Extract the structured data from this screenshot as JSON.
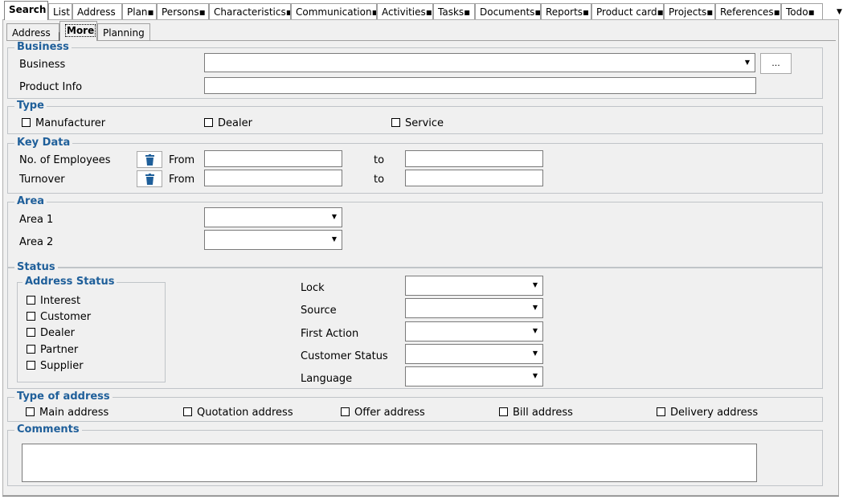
{
  "top_tabs": [
    "Search",
    "List",
    "Address",
    "Plan▪",
    "Persons▪",
    "Characteristics▪",
    "Communication▪",
    "Activities▪",
    "Tasks▪",
    "Documents▪",
    "Reports▪",
    "Product card▪",
    "Projects▪",
    "References▪",
    "Todo▪"
  ],
  "menu_arrow": "▼",
  "sub_tabs": [
    "Address",
    "More",
    "Planning"
  ],
  "business": {
    "title": "Business",
    "business_label": "Business",
    "browse_button": "...",
    "product_info_label": "Product Info"
  },
  "type": {
    "title": "Type",
    "manufacturer": "Manufacturer",
    "dealer": "Dealer",
    "service": "Service"
  },
  "key_data": {
    "title": "Key Data",
    "employees_label": "No. of Employees",
    "turnover_label": "Turnover",
    "from": "From",
    "to": "to"
  },
  "area": {
    "title": "Area",
    "area1": "Area 1",
    "area2": "Area 2"
  },
  "status": {
    "title": "Status",
    "address_status_title": "Address Status",
    "interest": "Interest",
    "customer": "Customer",
    "dealer": "Dealer",
    "partner": "Partner",
    "supplier": "Supplier",
    "lock": "Lock",
    "source": "Source",
    "first_action": "First Action",
    "customer_status": "Customer Status",
    "language": "Language"
  },
  "type_of_address": {
    "title": "Type of address",
    "main": "Main address",
    "quotation": "Quotation address",
    "offer": "Offer address",
    "bill": "Bill address",
    "delivery": "Delivery address"
  },
  "comments": {
    "title": "Comments"
  }
}
